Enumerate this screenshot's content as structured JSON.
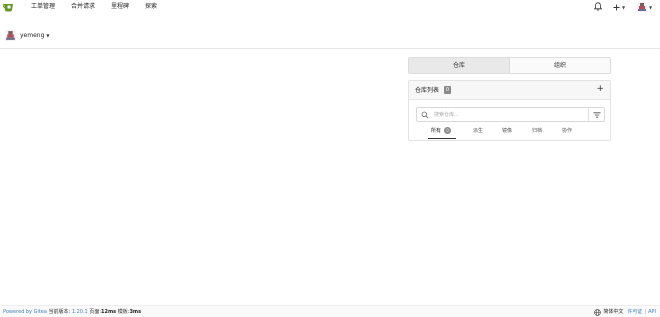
{
  "navbar": {
    "items": [
      "工单管理",
      "合并请求",
      "里程碑",
      "探索"
    ]
  },
  "context": {
    "username": "yemeng"
  },
  "repo_panel": {
    "tabs": [
      "仓库",
      "组织"
    ],
    "title": "仓库列表",
    "count": "0",
    "search_placeholder": "搜索仓库...",
    "subtabs": [
      "所有",
      "派生",
      "镜像",
      "归档",
      "协作"
    ],
    "all_count": "0"
  },
  "footer": {
    "powered": "Powered by Gitea",
    "version_label": "当前版本:",
    "version": "1.20.1",
    "page_label": "页面:",
    "page_time": "12ms",
    "template_label": "模板:",
    "template_time": "3ms",
    "language": "简体中文",
    "license": "许可证",
    "api": "API"
  },
  "colors": {
    "brand_green": "#609926",
    "link_blue": "#4183c4"
  },
  "icons": [
    "gitea-logo-icon",
    "bell-icon",
    "plus-icon",
    "avatar",
    "search-icon",
    "filter-icon",
    "globe-icon"
  ]
}
